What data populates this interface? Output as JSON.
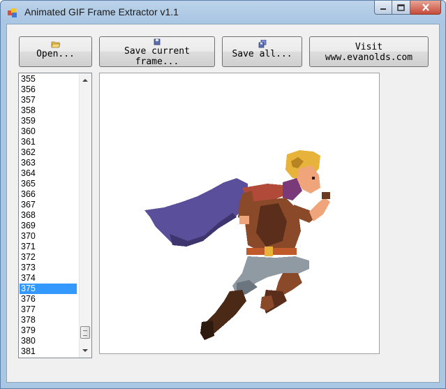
{
  "window": {
    "title": "Animated GIF Frame Extractor v1.1",
    "icons": {
      "app": "app-icon",
      "minimize": "minimize-icon",
      "maximize": "maximize-icon",
      "close": "close-icon"
    }
  },
  "toolbar": {
    "open_label": "Open...",
    "open_icon": "folder-open-icon",
    "save_current_line1": "Save current",
    "save_current_line2": "frame...",
    "save_current_icon": "floppy-disk-icon",
    "save_all_label": "Save all...",
    "save_all_icon": "multiple-disks-icon",
    "visit_line1": "Visit",
    "visit_line2": "www.evanolds.com"
  },
  "frame_list": {
    "items": [
      "355",
      "356",
      "357",
      "358",
      "359",
      "360",
      "361",
      "362",
      "363",
      "364",
      "365",
      "366",
      "367",
      "368",
      "369",
      "370",
      "371",
      "372",
      "373",
      "374",
      "375",
      "376",
      "377",
      "378",
      "379",
      "380",
      "381"
    ],
    "selected": "375"
  },
  "preview": {
    "content": "pixel-art running character with purple cape",
    "colors": {
      "cape": "#5a4f9b",
      "hair": "#e7b33a",
      "skin": "#f0a47a",
      "tunic": "#8a4a2a",
      "pants": "#8f9aa3"
    }
  }
}
